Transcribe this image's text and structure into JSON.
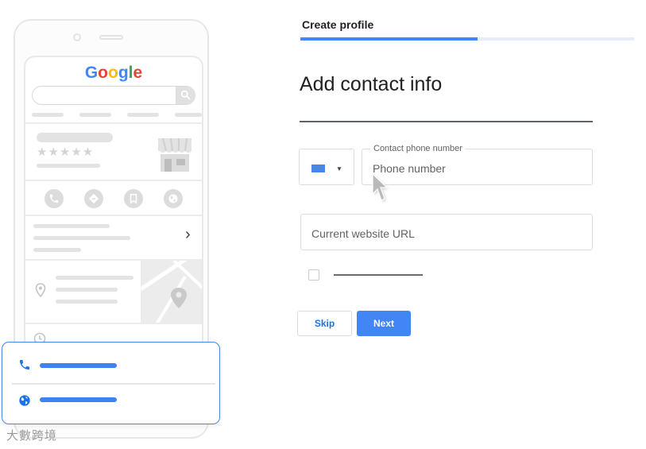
{
  "header": {
    "title": "Create profile",
    "progress": 0.53
  },
  "form": {
    "heading": "Add contact info",
    "country": {
      "flag_color": "#4a86e8",
      "caret": "▼"
    },
    "phone": {
      "label": "Contact phone number",
      "placeholder": "Phone number"
    },
    "website": {
      "placeholder": "Current website URL"
    },
    "skip_label": "Skip",
    "next_label": "Next"
  },
  "preview": {
    "logo_letters": [
      "G",
      "o",
      "o",
      "g",
      "l",
      "e"
    ],
    "logo_colors": [
      "#4285f4",
      "#ea4335",
      "#fbbc05",
      "#4285f4",
      "#34a853",
      "#ea4335"
    ],
    "stars": "★★★★★",
    "chevron": "›",
    "action_icons": [
      "phone-icon",
      "directions-icon",
      "bookmark-icon",
      "globe-icon"
    ]
  },
  "watermark": "大數跨境",
  "colors": {
    "accent": "#4285f4",
    "card_border": "#4a86e8"
  }
}
